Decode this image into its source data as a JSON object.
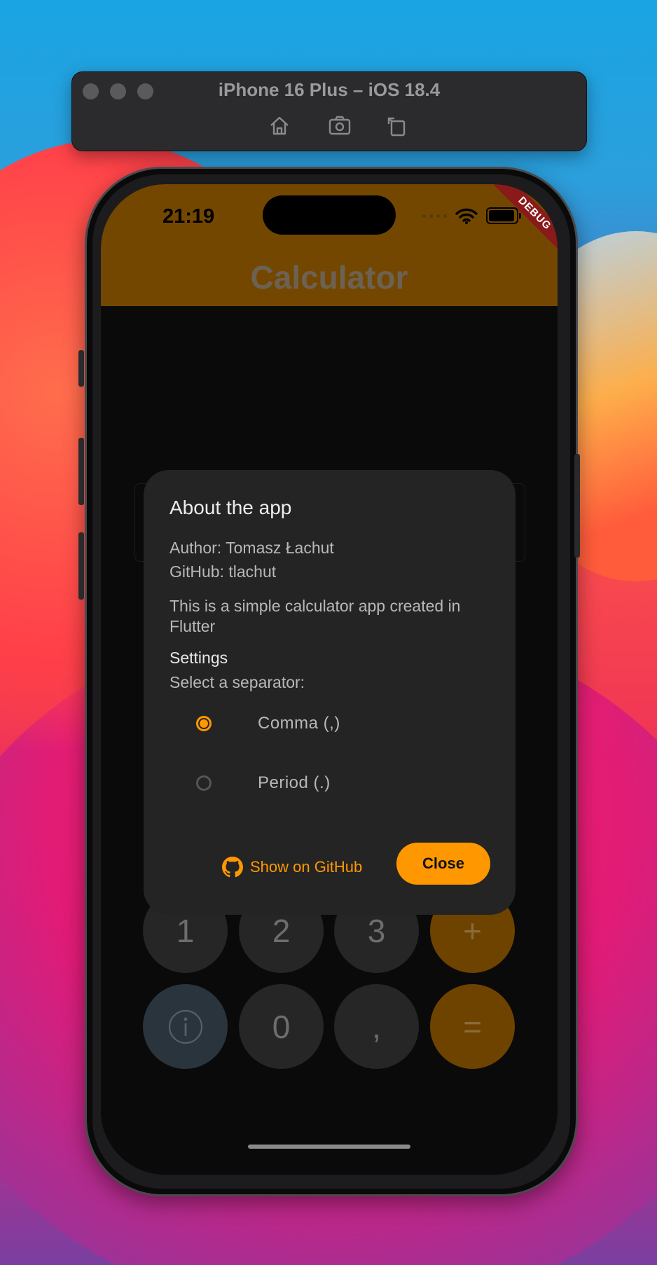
{
  "simulator": {
    "title": "iPhone 16 Plus – iOS 18.4",
    "tools": [
      "home-icon",
      "screenshot-icon",
      "rotate-icon"
    ]
  },
  "status_bar": {
    "time": "21:19",
    "debug_label": "DEBUG"
  },
  "app": {
    "title": "Calculator"
  },
  "keypad": {
    "row1": [
      "1",
      "2",
      "3",
      "+"
    ],
    "row2": [
      "i",
      "0",
      ",",
      "="
    ]
  },
  "dialog": {
    "title": "About the app",
    "author": "Author: Tomasz Łachut",
    "github": "GitHub: tlachut",
    "description": "This is a simple calculator app created in Flutter",
    "settings_heading": "Settings",
    "separator_prompt": "Select a separator:",
    "options": [
      {
        "label": "Comma (,)",
        "selected": true
      },
      {
        "label": "Period (.)",
        "selected": false
      }
    ],
    "github_button": "Show on GitHub",
    "close_button": "Close"
  },
  "colors": {
    "accent": "#ff9800",
    "app_bar": "#744700",
    "dialog_bg": "#242424"
  }
}
